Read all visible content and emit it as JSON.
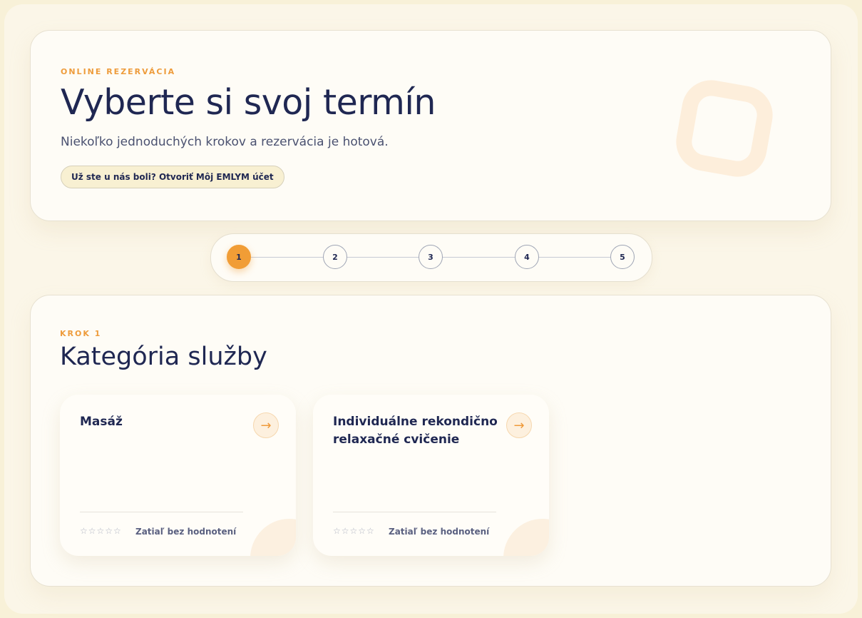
{
  "header": {
    "eyebrow": "ONLINE REZERVÁCIA",
    "title": "Vyberte si svoj termín",
    "subtitle": "Niekoľko jednoduchých krokov a rezervácia je hotová.",
    "account_button": "Už ste u nás boli? Otvoriť Môj EMLYM účet"
  },
  "stepper": {
    "steps": [
      "1",
      "2",
      "3",
      "4",
      "5"
    ],
    "active": 1
  },
  "step": {
    "eyebrow": "KROK 1",
    "title": "Kategória služby",
    "categories": [
      {
        "name": "Masáž",
        "stars": "☆☆☆☆☆",
        "rating_text": "Zatiaľ bez hodnotení",
        "arrow": "→"
      },
      {
        "name": "Individuálne rekondično relaxačné cvičenie",
        "stars": "☆☆☆☆☆",
        "rating_text": "Zatiaľ bez hodnotení",
        "arrow": "→"
      }
    ]
  },
  "colors": {
    "accent": "#f19d36",
    "navy": "#1f2752",
    "background": "#f8f1d8"
  }
}
